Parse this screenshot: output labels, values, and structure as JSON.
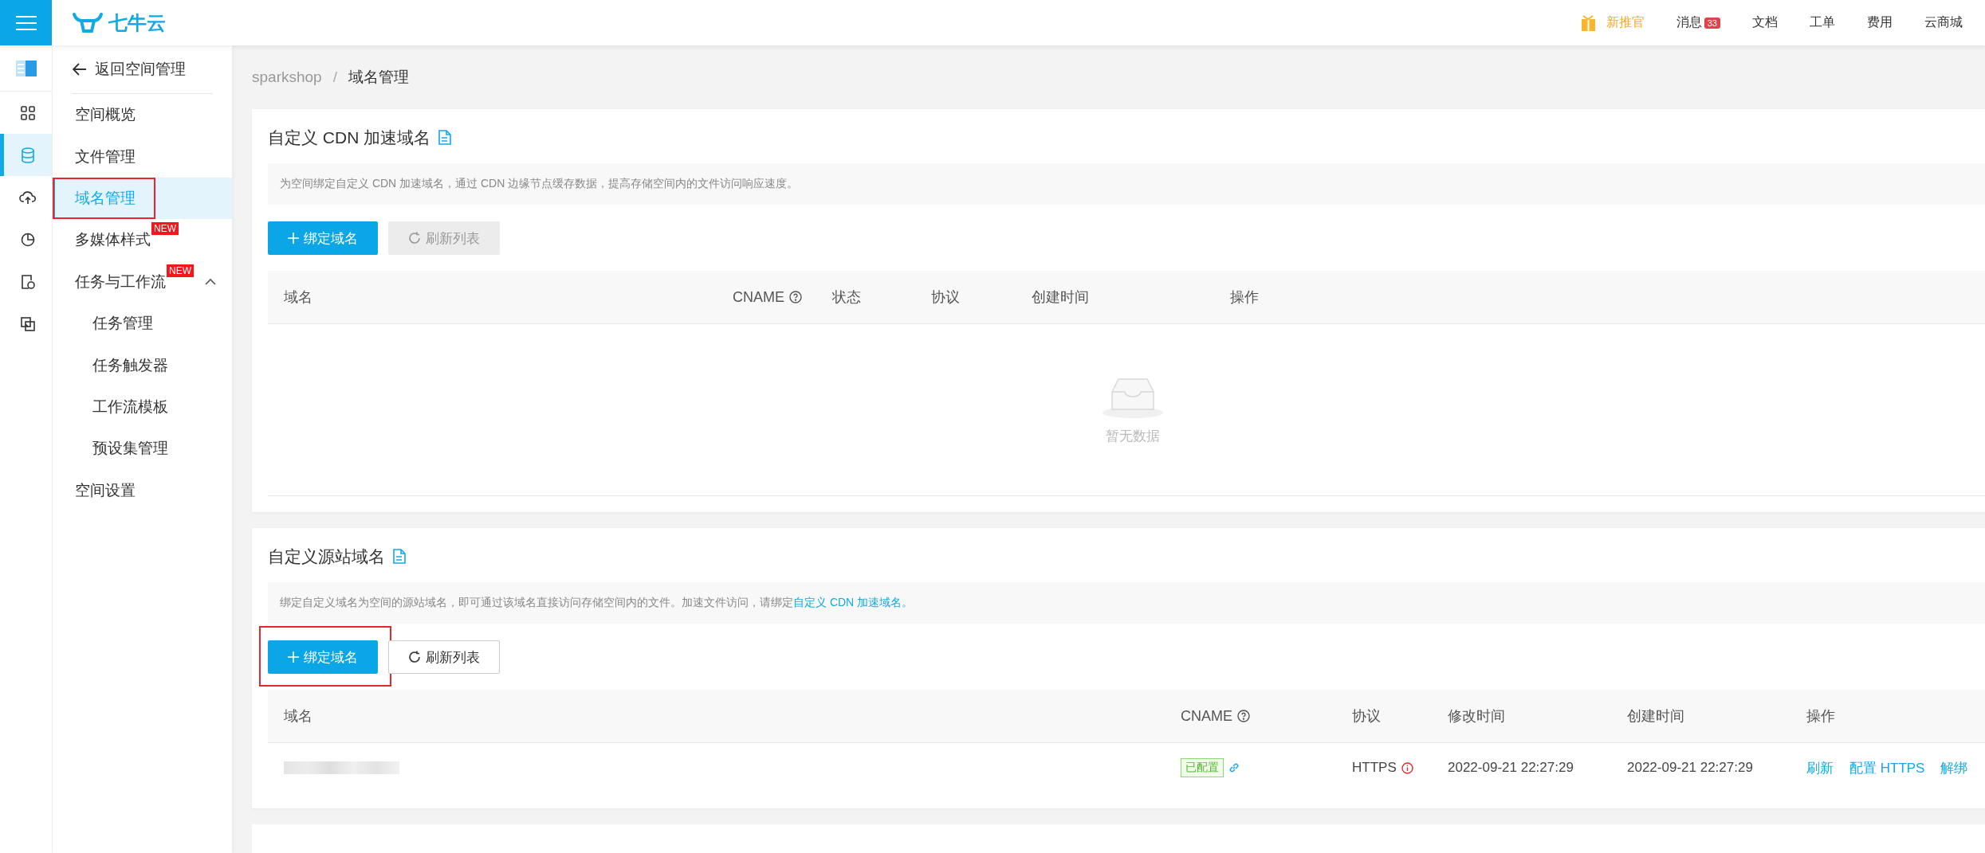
{
  "topbar": {
    "logo": "七牛云",
    "promo": "新推官",
    "nav": [
      {
        "label": "消息",
        "badge": "33"
      },
      {
        "label": "文档"
      },
      {
        "label": "工单"
      },
      {
        "label": "费用"
      },
      {
        "label": "云商城"
      }
    ]
  },
  "rail": [
    {
      "selected": false
    },
    {
      "selected": true
    },
    {
      "selected": false
    },
    {
      "selected": false
    },
    {
      "selected": false
    },
    {
      "selected": false
    }
  ],
  "sidebar": {
    "back": "返回空间管理",
    "items": [
      {
        "label": "空间概览",
        "selected": false,
        "highlighted": false
      },
      {
        "label": "文件管理",
        "selected": false,
        "highlighted": false
      },
      {
        "label": "域名管理",
        "selected": true,
        "highlighted": true
      },
      {
        "label": "多媒体样式",
        "badge": "NEW",
        "selected": false,
        "highlighted": false
      },
      {
        "label": "任务与工作流",
        "badge": "NEW",
        "expanded": true,
        "selected": false,
        "highlighted": false,
        "children": [
          {
            "label": "任务管理",
            "selected": false,
            "highlighted": false
          },
          {
            "label": "任务触发器",
            "selected": false,
            "highlighted": false
          },
          {
            "label": "工作流模板",
            "selected": false,
            "highlighted": false
          },
          {
            "label": "预设集管理",
            "selected": false,
            "highlighted": false
          }
        ]
      },
      {
        "label": "空间设置",
        "selected": false,
        "highlighted": false
      }
    ]
  },
  "breadcrumb": {
    "items": [
      "sparkshop",
      "域名管理"
    ],
    "separator": "/"
  },
  "sections": [
    {
      "title": "自定义 CDN 加速域名",
      "description": {
        "text": "为空间绑定自定义 CDN 加速域名，通过 CDN 边缘节点缓存数据，提高存储空间内的文件访问响应速度。"
      },
      "buttons": [
        {
          "kind": "add",
          "label": "绑定域名",
          "disabled": false,
          "highlighted": false
        },
        {
          "kind": "refresh",
          "label": "刷新列表",
          "disabled": true,
          "highlighted": false
        }
      ],
      "table": {
        "columns": [
          {
            "label": "域名",
            "help": false
          },
          {
            "label": "CNAME",
            "help": true
          },
          {
            "label": "状态",
            "help": false
          },
          {
            "label": "协议",
            "help": false
          },
          {
            "label": "创建时间",
            "help": false
          },
          {
            "label": "操作",
            "help": false
          }
        ],
        "empty_text": "暂无数据"
      }
    },
    {
      "title": "自定义源站域名",
      "description": {
        "text": "绑定自定义域名为空间的源站域名，即可通过该域名直接访问存储空间内的文件。加速文件访问，请绑定",
        "link": "自定义 CDN 加速域名。"
      },
      "buttons": [
        {
          "kind": "add",
          "label": "绑定域名",
          "disabled": false,
          "highlighted": true
        },
        {
          "kind": "refresh",
          "label": "刷新列表",
          "disabled": false,
          "highlighted": false
        }
      ],
      "table": {
        "columns": [
          {
            "label": "域名",
            "help": false
          },
          {
            "label": "CNAME",
            "help": true
          },
          {
            "label": "协议",
            "help": false
          },
          {
            "label": "修改时间",
            "help": false
          },
          {
            "label": "创建时间",
            "help": false
          },
          {
            "label": "操作",
            "help": false
          }
        ],
        "rows": [
          {
            "cname_status": "已配置",
            "protocol": "HTTPS",
            "protocol_warning": true,
            "modified": "2022-09-21 22:27:29",
            "created": "2022-09-21 22:27:29",
            "actions": [
              "刷新",
              "配置 HTTPS",
              "解绑"
            ]
          }
        ]
      }
    }
  ]
}
